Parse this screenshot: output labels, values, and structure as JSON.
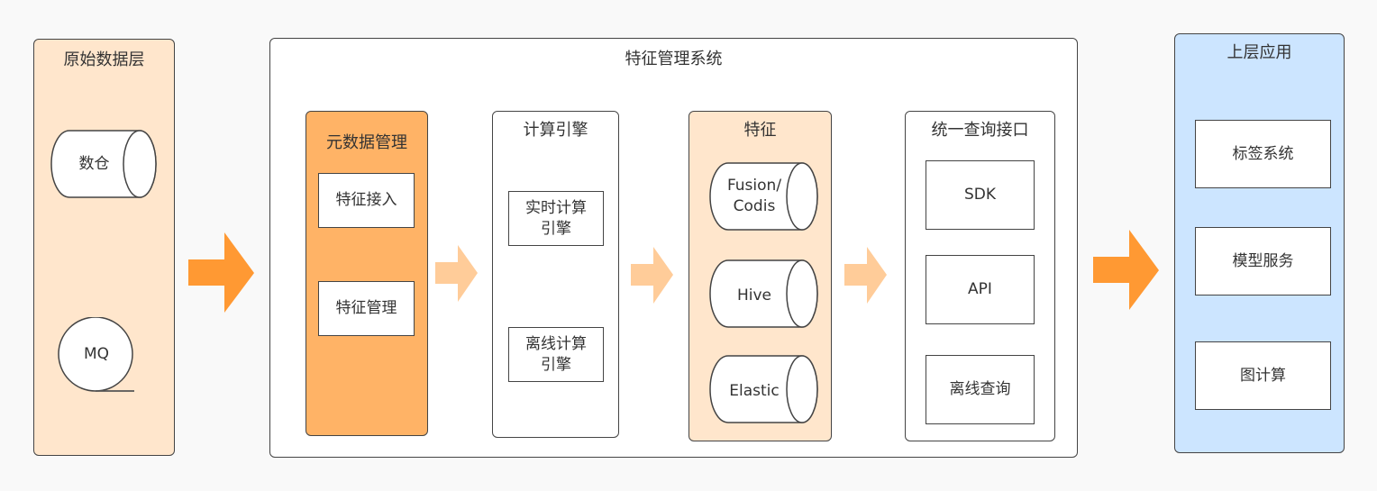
{
  "colors": {
    "background": "#f9f9f9",
    "raw_layer_fill": "#ffe6cc",
    "metadata_fill": "#ffb366",
    "feature_fill": "#ffe6cc",
    "upper_layer_fill": "#cce5ff",
    "arrow_strong": "#ff9933",
    "arrow_light": "#ffcc99",
    "border": "#444444"
  },
  "raw_layer": {
    "title": "原始数据层",
    "items": [
      {
        "label": "数仓",
        "shape": "cylinder-icon"
      },
      {
        "label": "MQ",
        "shape": "queue-icon"
      }
    ]
  },
  "system": {
    "title": "特征管理系统",
    "metadata": {
      "title": "元数据管理",
      "items": [
        "特征接入",
        "特征管理"
      ]
    },
    "compute": {
      "title": "计算引擎",
      "items": [
        "实时计算\n引擎",
        "离线计算\n引擎"
      ]
    },
    "features": {
      "title": "特征",
      "items": [
        "Fusion/\nCodis",
        "Hive",
        "Elastic"
      ]
    },
    "query": {
      "title": "统一查询接口",
      "items": [
        "SDK",
        "API",
        "离线查询"
      ]
    }
  },
  "upper_layer": {
    "title": "上层应用",
    "items": [
      "标签系统",
      "模型服务",
      "图计算"
    ]
  }
}
